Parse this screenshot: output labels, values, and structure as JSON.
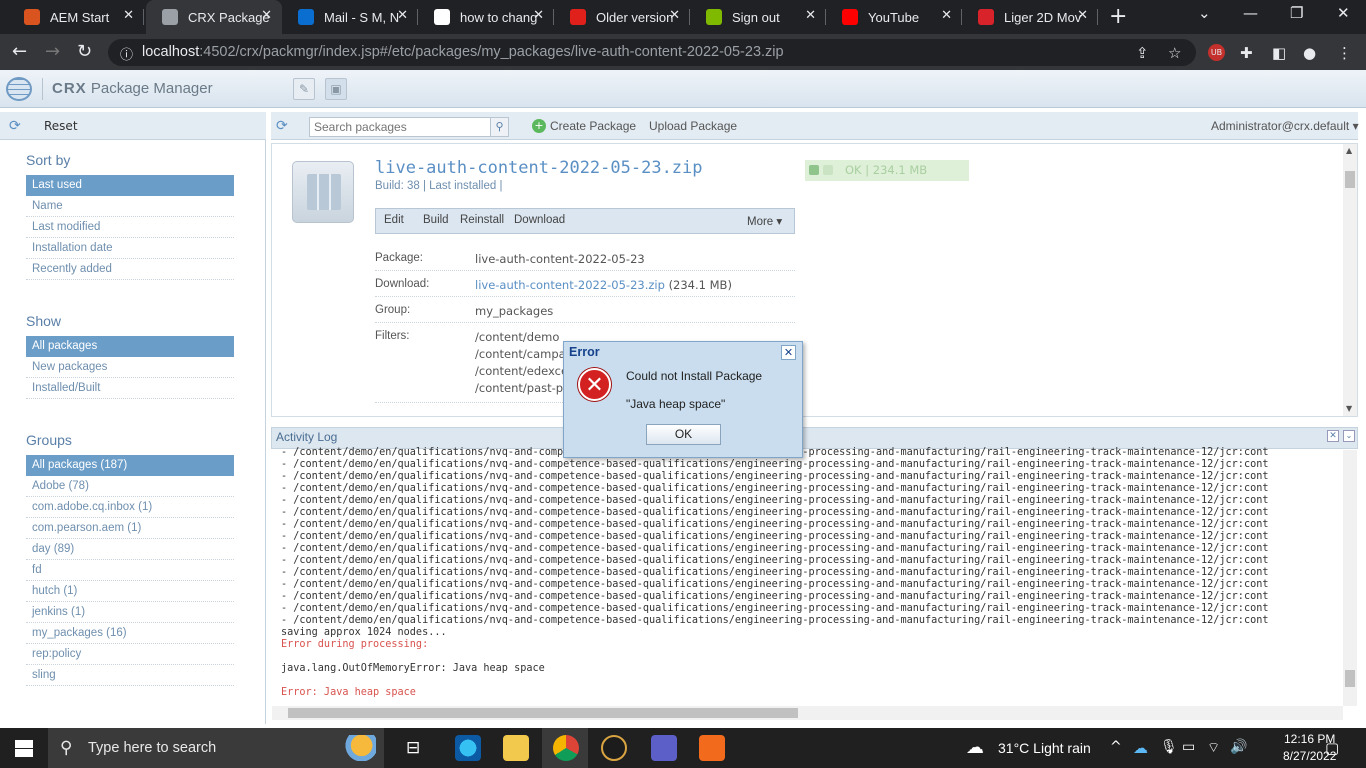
{
  "browser": {
    "tabs": [
      {
        "label": "AEM Start",
        "favicon_color": "#d9541e",
        "active": false
      },
      {
        "label": "CRX Package",
        "favicon_color": "#9aa0a6",
        "active": true
      },
      {
        "label": "Mail - S M, N",
        "favicon_color": "#0a6ed1",
        "active": false
      },
      {
        "label": "how to chang",
        "favicon_color": "#ffffff",
        "active": false
      },
      {
        "label": "Older version",
        "favicon_color": "#e0201b",
        "active": false
      },
      {
        "label": "Sign out",
        "favicon_color": "#7fba00",
        "active": false
      },
      {
        "label": "YouTube",
        "favicon_color": "#ff0000",
        "active": false
      },
      {
        "label": "Liger 2D Mov",
        "favicon_color": "#d8232a",
        "active": false
      }
    ],
    "url_host": "localhost",
    "url_path": ":4502/crx/packmgr/index.jsp#/etc/packages/my_packages/live-auth-content-2022-05-23.zip"
  },
  "app": {
    "title_brand": "CRX",
    "title_rest": "Package Manager"
  },
  "left": {
    "reset_label": "Reset",
    "sort_heading": "Sort by",
    "sort_items": [
      "Last used",
      "Name",
      "Last modified",
      "Installation date",
      "Recently added"
    ],
    "show_heading": "Show",
    "show_items": [
      "All packages",
      "New packages",
      "Installed/Built"
    ],
    "groups_heading": "Groups",
    "group_items": [
      "All packages (187)",
      "Adobe (78)",
      "com.adobe.cq.inbox (1)",
      "com.pearson.aem (1)",
      "day (89)",
      "fd",
      "hutch (1)",
      "jenkins (1)",
      "my_packages (16)",
      "rep:policy",
      "sling"
    ]
  },
  "main": {
    "search_placeholder": "Search packages",
    "create_label": "Create Package",
    "upload_label": "Upload Package",
    "user_label": "Administrator@crx.default"
  },
  "package": {
    "name": "live-auth-content-2022-05-23.zip",
    "build_line": "Build: 38 | Last installed |",
    "status": "OK  |  234.1 MB",
    "actions": [
      "Edit",
      "Build",
      "Reinstall",
      "Download"
    ],
    "more_label": "More",
    "package_label": "Package:",
    "package_value": "live-auth-content-2022-05-23",
    "download_label": "Download:",
    "download_link": "live-auth-content-2022-05-23.zip",
    "download_size": "(234.1 MB)",
    "group_label": "Group:",
    "group_value": "my_packages",
    "filters_label": "Filters:",
    "filters": [
      "/content/demo",
      "/content/campa",
      "/content/edexce",
      "/content/past-p"
    ]
  },
  "log": {
    "title": "Activity Log",
    "path_line": "- /content/demo/en/qualifications/nvq-and-competence-based-qualifications/engineering-processing-and-manufacturing/rail-engineering-track-maintenance-12/jcr:cont",
    "path_line_count": 15,
    "saving": "saving approx 1024 nodes...",
    "error_processing": "Error during processing:",
    "exception": "java.lang.OutOfMemoryError: Java heap space",
    "final_error": "Error: Java heap space"
  },
  "dialog": {
    "title": "Error",
    "message": "Could not Install Package",
    "detail": "\"Java heap space\"",
    "ok_label": "OK"
  },
  "taskbar": {
    "search_placeholder": "Type here to search",
    "weather": "31°C  Light rain",
    "time": "12:16 PM",
    "date": "8/27/2022"
  }
}
